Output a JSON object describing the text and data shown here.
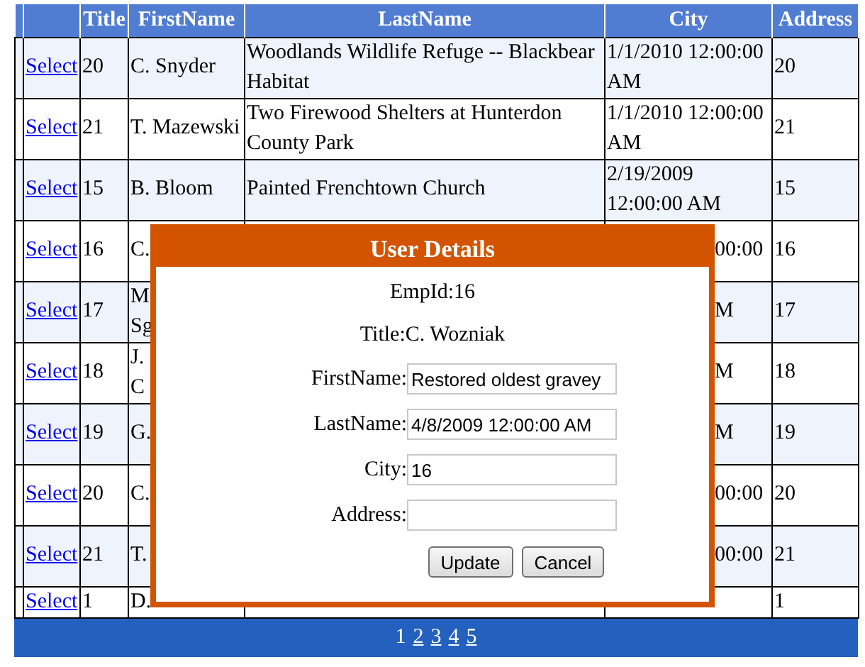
{
  "table": {
    "columns": [
      "Title",
      "FirstName",
      "LastName",
      "City",
      "Address"
    ],
    "rows": [
      {
        "link": "Select",
        "title": "20",
        "first_name": "C. Snyder",
        "last_name": "Woodlands Wildlife Refuge -- Blackbear Habitat",
        "city": "1/1/2010 12:00:00 AM",
        "address": "20"
      },
      {
        "link": "Select",
        "title": "21",
        "first_name": "T. Mazewski",
        "last_name": "Two Firewood Shelters at Hunterdon County Park",
        "city": "1/1/2010 12:00:00 AM",
        "address": "21"
      },
      {
        "link": "Select",
        "title": "15",
        "first_name": "B. Bloom",
        "last_name": "Painted Frenchtown Church",
        "city": "2/19/2009 12:00:00 AM",
        "address": "15"
      },
      {
        "link": "Select",
        "title": "16",
        "first_name_fragment": "C.",
        "city_fragment": "00:00",
        "address": "16"
      },
      {
        "link": "Select",
        "title": "17",
        "first_name_fragment": "M Sg",
        "city_fragment": "M",
        "address": "17"
      },
      {
        "link": "Select",
        "title": "18",
        "first_name_fragment": "J. C",
        "city_fragment": "M",
        "address": "18"
      },
      {
        "link": "Select",
        "title": "19",
        "first_name_fragment": "G.",
        "city_fragment": "M",
        "address": "19"
      },
      {
        "link": "Select",
        "title": "20",
        "first_name_fragment": "C.",
        "city_fragment": "00:00",
        "address": "20"
      },
      {
        "link": "Select",
        "title": "21",
        "first_name_fragment": "T.",
        "city_fragment": "00:00",
        "address": "21"
      },
      {
        "link": "Select",
        "title": "1",
        "first_name_fragment": "D.",
        "address": "1"
      }
    ]
  },
  "pager": [
    {
      "label": "1",
      "selected": true
    },
    {
      "label": "2",
      "selected": false
    },
    {
      "label": "3",
      "selected": false
    },
    {
      "label": "4",
      "selected": false
    },
    {
      "label": "5",
      "selected": false
    }
  ],
  "dialog": {
    "title": "User Details",
    "fields": [
      {
        "kind": "text",
        "label": "EmpId:",
        "value": "16"
      },
      {
        "kind": "text",
        "label": "Title:",
        "value": "C. Wozniak"
      },
      {
        "kind": "input",
        "label": "FirstName:",
        "value": "Restored oldest gravey"
      },
      {
        "kind": "input",
        "label": "LastName:",
        "value": "4/8/2009 12:00:00 AM"
      },
      {
        "kind": "input",
        "label": "City:",
        "value": "16"
      },
      {
        "kind": "input",
        "label": "Address:"
      }
    ],
    "buttons": [
      "Update",
      "Cancel"
    ]
  }
}
